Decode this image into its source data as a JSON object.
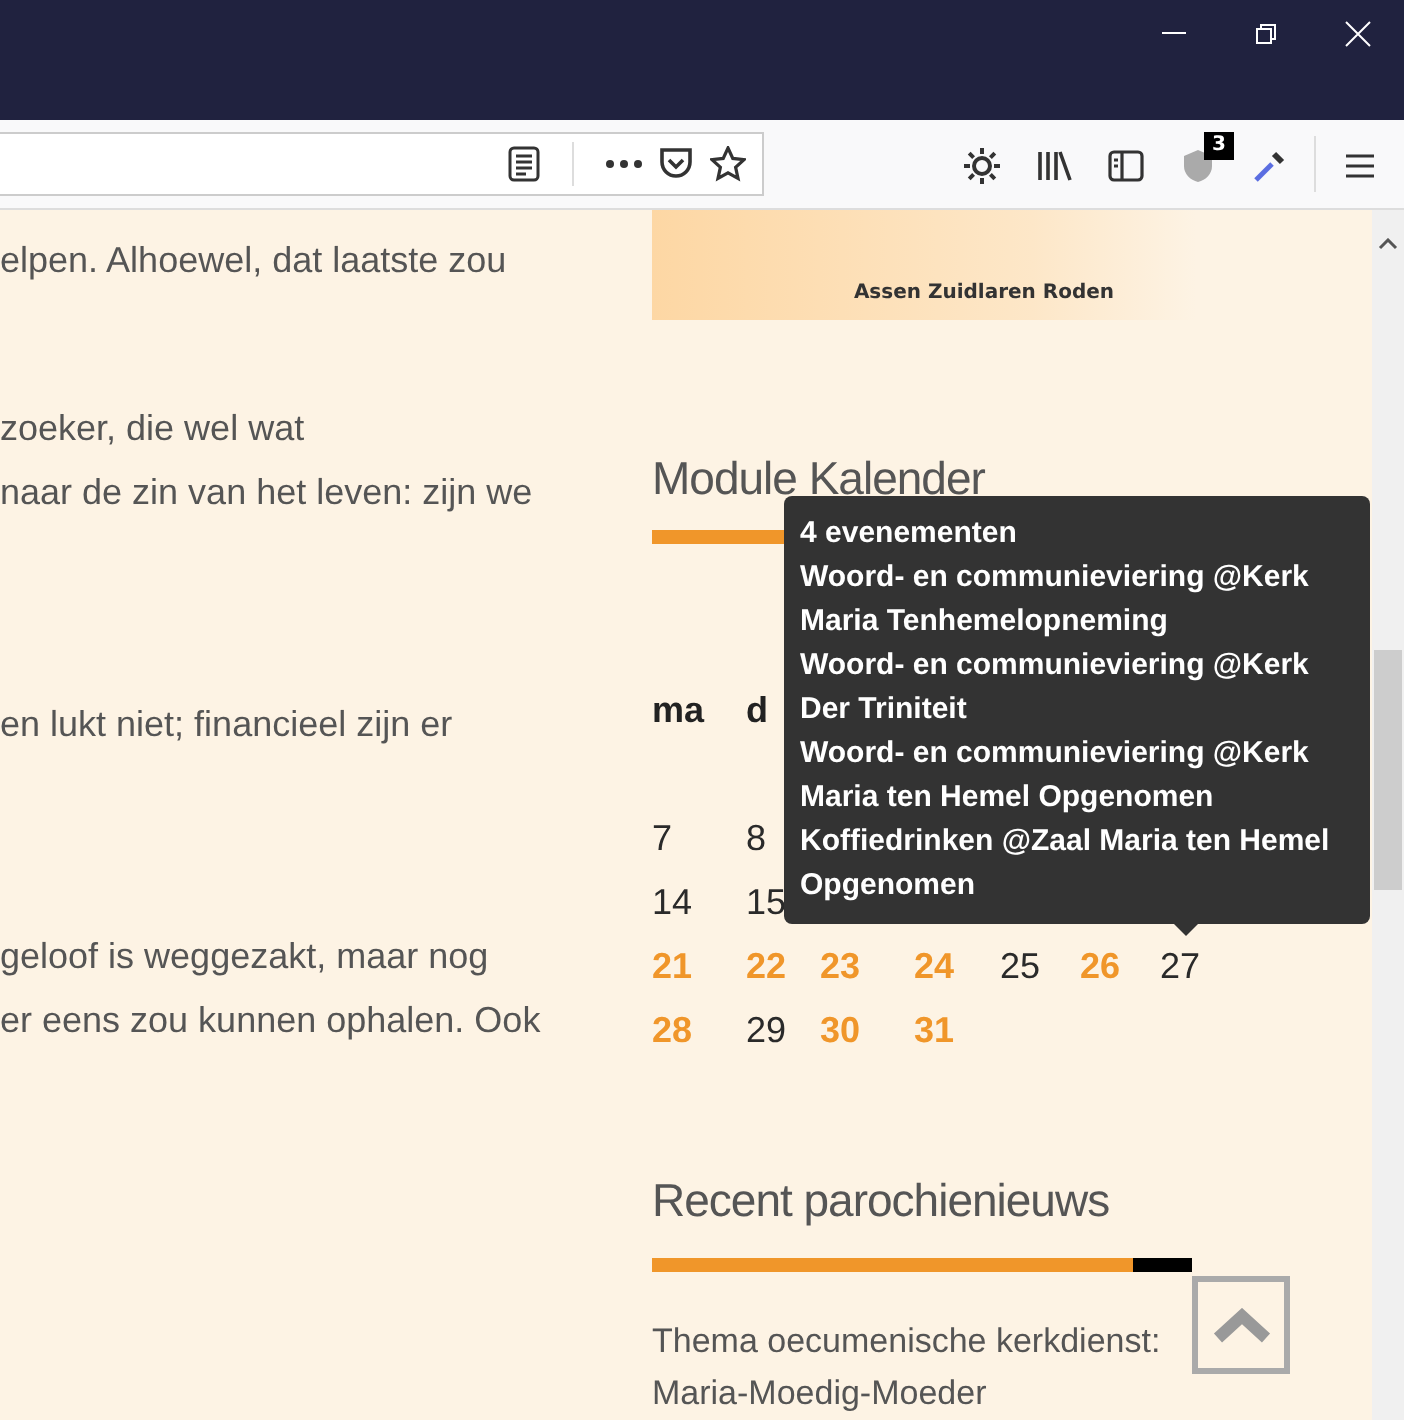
{
  "toolbar": {
    "shield_badge": "3"
  },
  "article_lines": [
    "elpen. Alhoewel, dat laatste zou",
    "zoeker, die wel wat",
    "naar de zin van het leven: zijn we",
    "en lukt niet; financieel zijn er",
    "geloof is weggezakt, maar nog",
    "er eens zou kunnen ophalen. Ook"
  ],
  "logo": {
    "text": "Assen Zuidlaren Roden"
  },
  "calendar": {
    "title": "Module Kalender",
    "weekdays": [
      {
        "kind": "shown",
        "label": "ma"
      },
      {
        "kind": "shown",
        "label": "d"
      },
      {
        "kind": "hidden"
      },
      {
        "kind": "hidden"
      },
      {
        "kind": "hidden"
      },
      {
        "kind": "hidden"
      },
      {
        "kind": "hidden"
      }
    ],
    "weeks": [
      [
        {
          "kind": "blank"
        },
        {
          "kind": "hidden"
        },
        {
          "kind": "hidden"
        },
        {
          "kind": "hidden"
        },
        {
          "kind": "hidden"
        },
        {
          "kind": "hidden"
        },
        {
          "kind": "hidden"
        }
      ],
      [
        {
          "kind": "day",
          "day": "7",
          "has_events": false
        },
        {
          "kind": "day",
          "day": "8",
          "has_events": false
        },
        {
          "kind": "hidden"
        },
        {
          "kind": "hidden"
        },
        {
          "kind": "hidden"
        },
        {
          "kind": "hidden"
        },
        {
          "kind": "hidden"
        }
      ],
      [
        {
          "kind": "day",
          "day": "14",
          "has_events": false
        },
        {
          "kind": "day",
          "day": "15",
          "has_events": false
        },
        {
          "kind": "hidden"
        },
        {
          "kind": "hidden"
        },
        {
          "kind": "hidden"
        },
        {
          "kind": "hidden"
        },
        {
          "kind": "hidden"
        }
      ],
      [
        {
          "kind": "day",
          "day": "21",
          "has_events": true
        },
        {
          "kind": "day",
          "day": "22",
          "has_events": true
        },
        {
          "kind": "day",
          "day": "23",
          "has_events": true
        },
        {
          "kind": "day",
          "day": "24",
          "has_events": true
        },
        {
          "kind": "day",
          "day": "25",
          "has_events": false
        },
        {
          "kind": "day",
          "day": "26",
          "has_events": true
        },
        {
          "kind": "day",
          "day": "27",
          "has_events": false
        }
      ],
      [
        {
          "kind": "day",
          "day": "28",
          "has_events": true
        },
        {
          "kind": "day",
          "day": "29",
          "has_events": false
        },
        {
          "kind": "day",
          "day": "30",
          "has_events": true
        },
        {
          "kind": "day",
          "day": "31",
          "has_events": true
        },
        {
          "kind": "blank"
        },
        {
          "kind": "blank"
        },
        {
          "kind": "blank"
        }
      ]
    ],
    "tooltip": {
      "title": "4 evenementen",
      "events": [
        "Woord- en communieviering @Kerk Maria Tenhemelopneming",
        "Woord- en communieviering @Kerk Der Triniteit",
        "Woord- en communieviering @Kerk Maria ten Hemel Opgenomen",
        "Koffiedrinken @Zaal Maria ten Hemel Opgenomen"
      ]
    }
  },
  "news": {
    "title": "Recent parochienieuws",
    "items": [
      "Thema oecumenische kerkdienst: Maria-Moedig-Moeder"
    ]
  }
}
